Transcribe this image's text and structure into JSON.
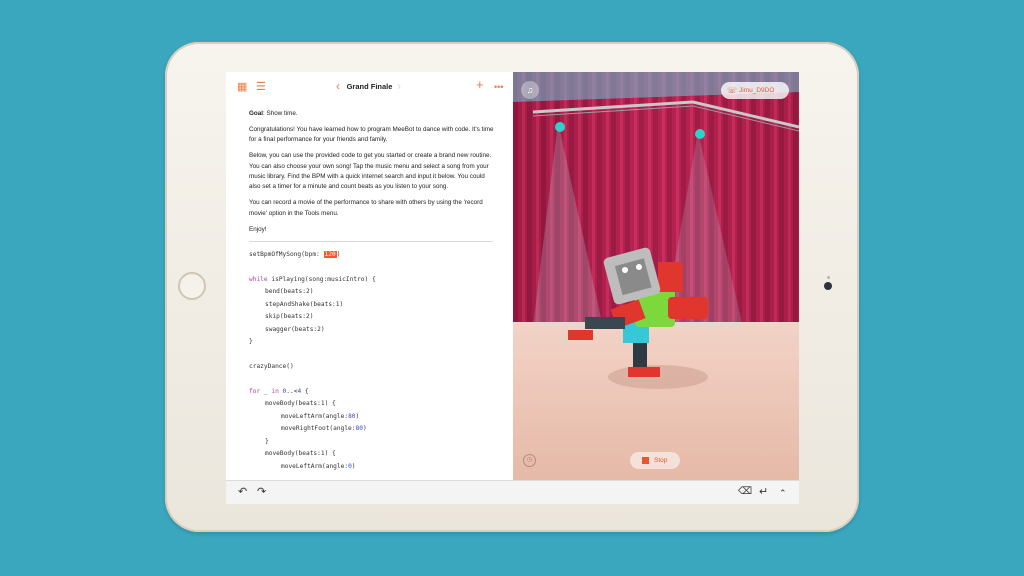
{
  "header": {
    "title": "Grand Finale",
    "grid_icon": "grid-icon",
    "list_icon": "list-icon",
    "back_icon": "chevron-left-icon",
    "forward_icon": "chevron-right-icon",
    "add_icon": "plus-icon",
    "more_icon": "more-icon"
  },
  "prose": {
    "goal_label": "Goal",
    "goal_text": ": Show time.",
    "p1": "Congratulations! You have learned how to program MeeBot to dance with code. It's time for a final performance for your friends and family.",
    "p2": "Below, you can use the provided code to get you started or create a brand new routine. You can also choose your own song! Tap the music menu and select a song from your music library. Find the BPM with a quick internet search and input it below. You could also set a timer for a minute and count beats as you listen to your song.",
    "p3": "You can record a movie of the performance to share with others by using the 'record movie' option in the Tools menu.",
    "p4": "Enjoy!"
  },
  "code": {
    "l1_pre": "setBpmOfMySong(bpm: ",
    "l1_val": "120",
    "l1_post": ")",
    "l2_kw": "while",
    "l2_rest": " isPlaying(song:musicIntro) {",
    "l3": "bend(beats:2)",
    "l4": "stepAndShake(beats:1)",
    "l5": "skip(beats:2)",
    "l6": "swagger(beats:2)",
    "l7": "}",
    "l8": "crazyDance()",
    "l9_kw1": "for",
    "l9_mid": " _ ",
    "l9_kw2": "in",
    "l9_num1": " 0",
    "l9_op": "..<",
    "l9_num2": "4",
    "l9_end": " {",
    "l10": "moveBody(beats:1) {",
    "l11_pre": "moveLeftArm(angle:",
    "l11_val": "80",
    "l11_post": ")",
    "l12_pre": "moveRightFoot(angle:",
    "l12_val": "80",
    "l12_post": ")",
    "l13": "}",
    "l14": "moveBody(beats:1) {",
    "l15_pre": "moveLeftArm(angle:",
    "l15_val": "0",
    "l15_post": ")"
  },
  "stage": {
    "device_name": "Jimu_D9DO",
    "stop_label": "Stop",
    "music_icon": "music-note-icon",
    "speed_icon": "speedometer-icon",
    "device_icon": "phone-link-icon"
  },
  "toolbar": {
    "undo_icon": "undo-icon",
    "redo_icon": "redo-icon",
    "delete_icon": "backspace-icon",
    "return_icon": "return-icon",
    "collapse_icon": "chevron-up-icon"
  },
  "colors": {
    "background": "#3ba7bf",
    "accent": "#f07a43",
    "keyword": "#b33fb2",
    "number": "#3b45c8",
    "highlight": "#f4572c",
    "curtain": "#b1204c"
  }
}
